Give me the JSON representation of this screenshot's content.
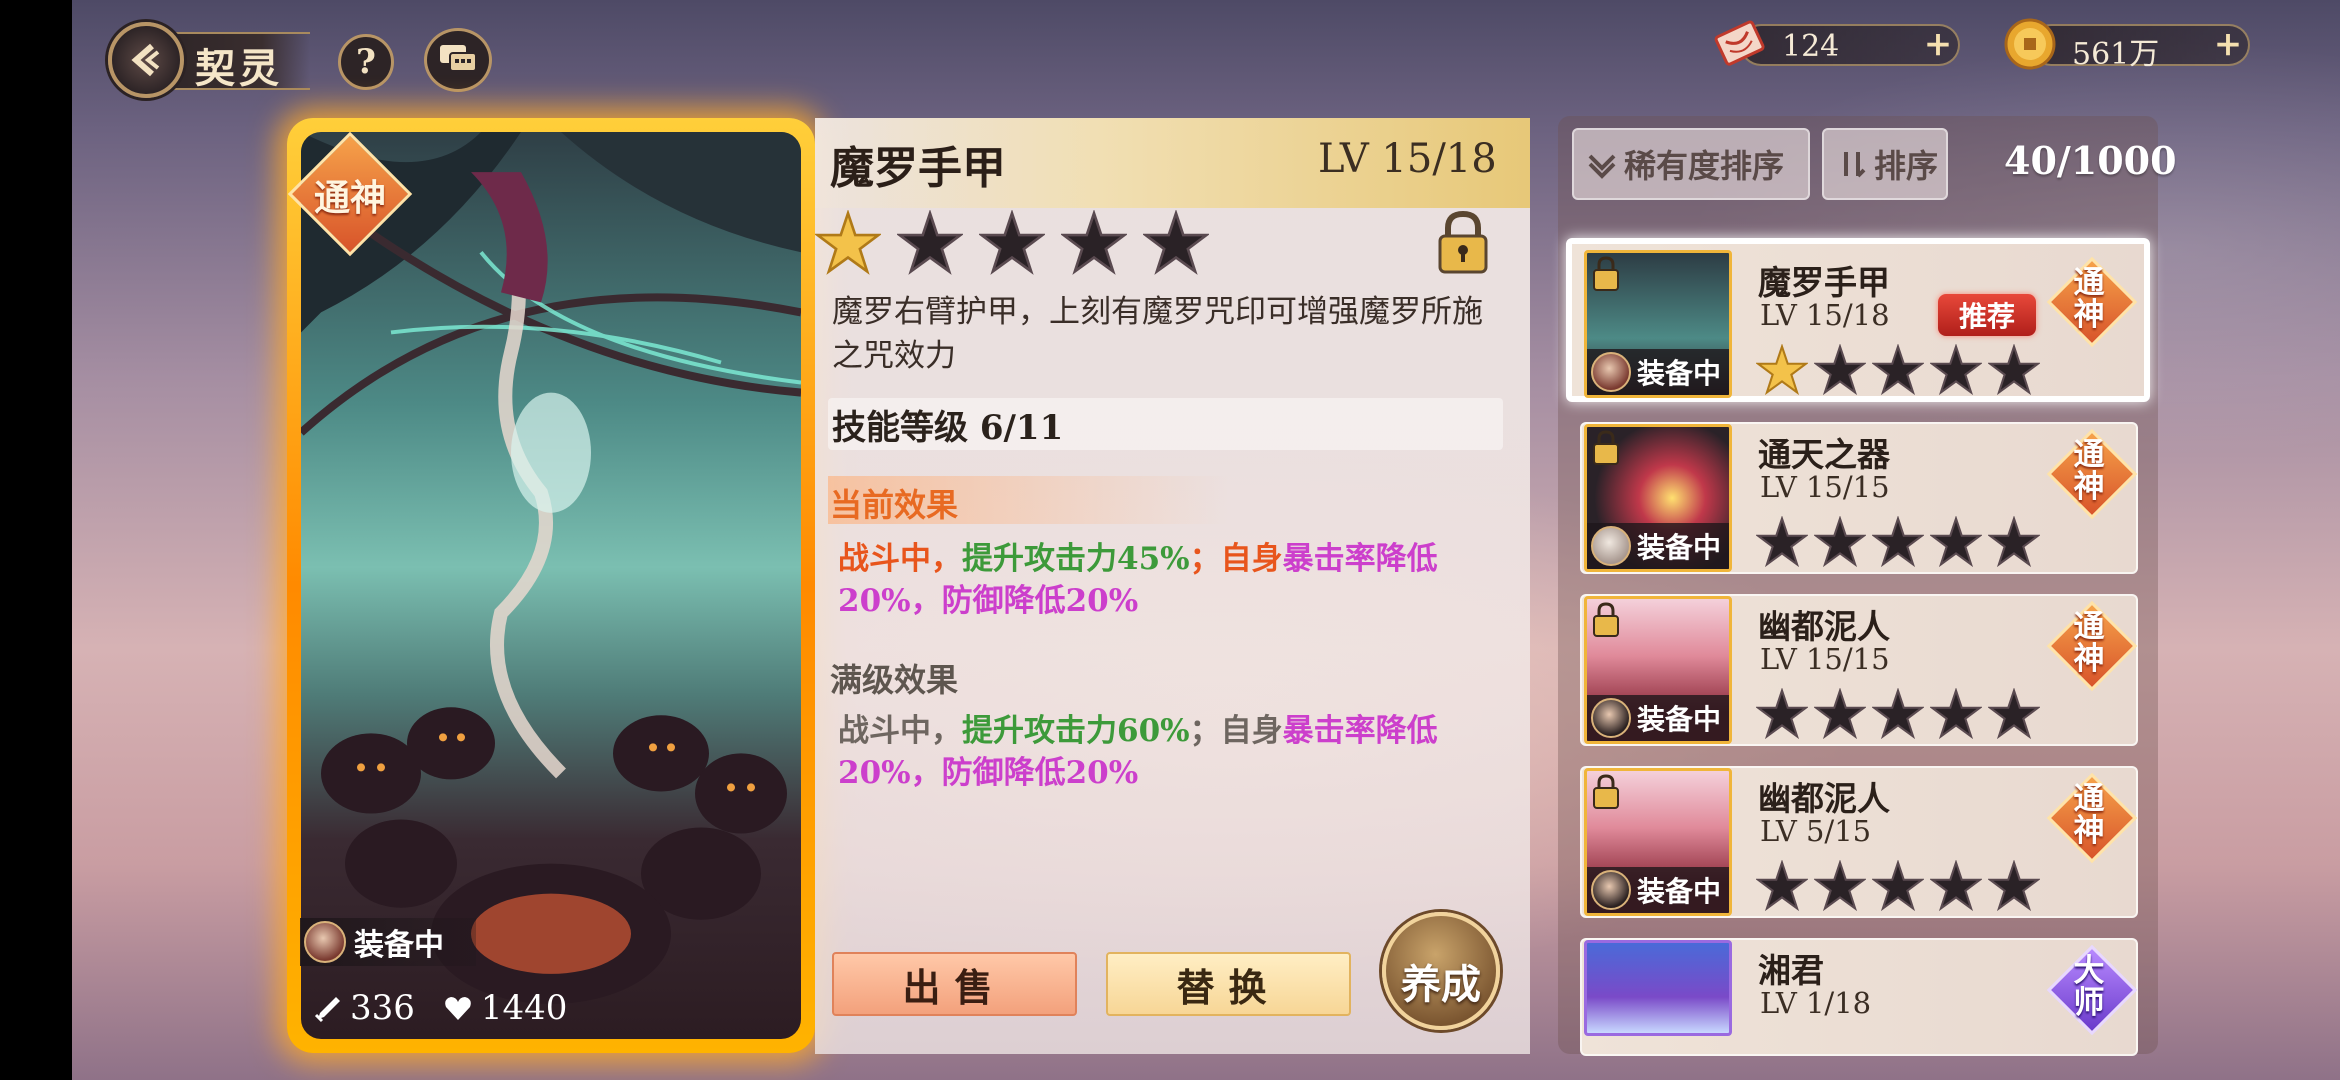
{
  "header": {
    "title": "契灵",
    "help_label": "?"
  },
  "currency": [
    {
      "name": "ticket",
      "value": "124",
      "plus": "+"
    },
    {
      "name": "coin",
      "value": "561万",
      "plus": "+"
    }
  ],
  "card": {
    "rarity": "通神",
    "equipped_label": "装备中",
    "attack": "336",
    "hp": "1440"
  },
  "detail": {
    "name": "魔罗手甲",
    "level": "LV 15/18",
    "stars_filled": 1,
    "stars_total": 5,
    "description": "魔罗右臂护甲，上刻有魔罗咒印可增强魔罗所施之咒效力",
    "skill_level": "技能等级 6/11",
    "current_title": "当前效果",
    "current_effect": {
      "p1": "战斗中，",
      "p2": "提升攻击力45%",
      "p3": "；自身",
      "p4": "暴击率降低20%，防御降低20%"
    },
    "max_title": "满级效果",
    "max_effect": {
      "p1": "战斗中，",
      "p2": "提升攻击力60%",
      "p3": "；自身",
      "p4": "暴击率降低20%，防御降低20%"
    },
    "sell_label": "出售",
    "replace_label": "替换",
    "cultivate_label": "养成"
  },
  "list": {
    "sort_rarity": "稀有度排序",
    "sort_order": "排序",
    "count": "40/1000",
    "items": [
      {
        "name": "魔罗手甲",
        "level": "LV 15/18",
        "equipped": "装备中",
        "rarity": "通神",
        "stars_filled": 1,
        "recommend": "推荐"
      },
      {
        "name": "通天之器",
        "level": "LV 15/15",
        "equipped": "装备中",
        "rarity": "通神",
        "stars_filled": 0
      },
      {
        "name": "幽都泥人",
        "level": "LV 15/15",
        "equipped": "装备中",
        "rarity": "通神",
        "stars_filled": 0
      },
      {
        "name": "幽都泥人",
        "level": "LV 5/15",
        "equipped": "装备中",
        "rarity": "通神",
        "stars_filled": 0
      },
      {
        "name": "湘君",
        "level": "LV 1/18",
        "rarity": "大师"
      }
    ]
  },
  "colors": {
    "gold_star": "#f3c24a",
    "dark_star": "#2a2226",
    "orange_text": "#e8551c",
    "green_text": "#3d9a3a",
    "pink_text": "#cc3fcc"
  }
}
